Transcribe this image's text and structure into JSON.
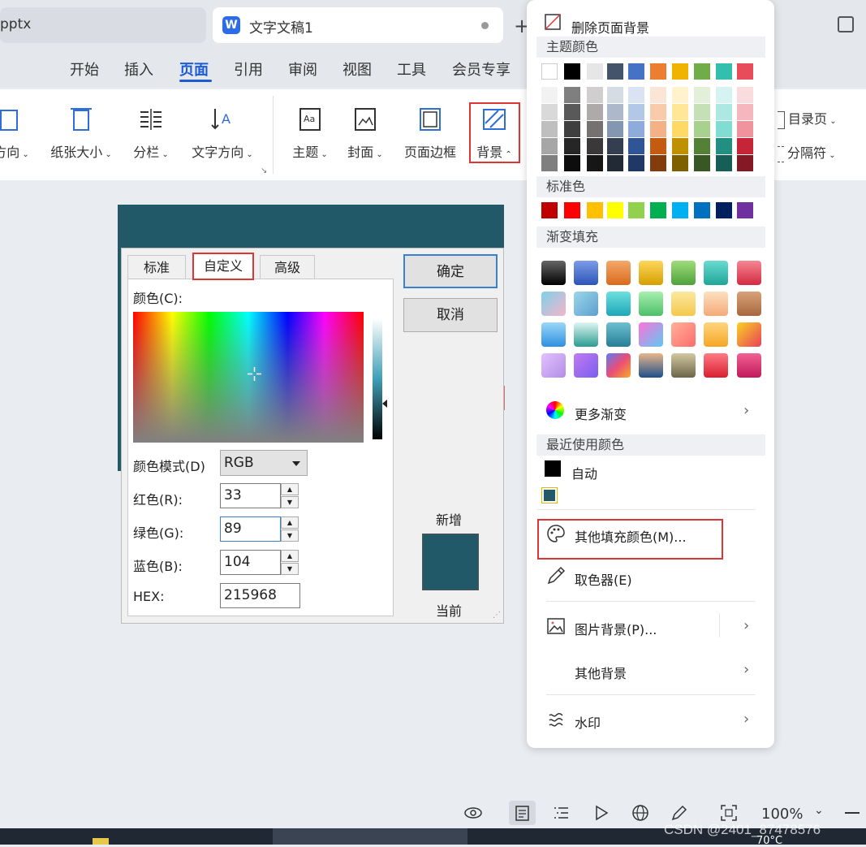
{
  "tabs": {
    "file1": "pptx",
    "file2": "文字文稿1",
    "file2_logo": "W"
  },
  "menu": [
    "开始",
    "插入",
    "页面",
    "引用",
    "审阅",
    "视图",
    "工具",
    "会员专享"
  ],
  "ribbon": {
    "orientation": "方向",
    "paper_size": "纸张大小",
    "columns": "分栏",
    "text_direction": "文字方向",
    "theme": "主题",
    "cover": "封面",
    "page_border": "页面边框",
    "background": "背景",
    "toc_page": "目录页",
    "separator": "分隔符"
  },
  "dialog": {
    "tabs": [
      "标准",
      "自定义",
      "高级"
    ],
    "color_label": "颜色(C):",
    "mode_label": "颜色模式(D)",
    "mode_value": "RGB",
    "red_label": "红色(R):",
    "red_value": "33",
    "green_label": "绿色(G):",
    "green_value": "89",
    "blue_label": "蓝色(B):",
    "blue_value": "104",
    "hex_label": "HEX:",
    "hex_value": "215968",
    "ok": "确定",
    "cancel": "取消",
    "new_label": "新增",
    "current_label": "当前"
  },
  "dropdown": {
    "remove_bg": "删除页面背景",
    "theme_colors": "主题颜色",
    "standard_colors": "标准色",
    "gradient_fill": "渐变填充",
    "more_gradients": "更多渐变",
    "recent_colors": "最近使用颜色",
    "auto": "自动",
    "other_fill": "其他填充颜色(M)...",
    "eyedropper": "取色器(E)",
    "picture_bg": "图片背景(P)...",
    "other_bg": "其他背景",
    "watermark": "水印"
  },
  "theme_top_row": [
    "#ffffff",
    "#000000",
    "#e7e6e6",
    "#44546a",
    "#4472c4",
    "#ed7d31",
    "#f0b400",
    "#70ad47",
    "#33bfae",
    "#e84c5a"
  ],
  "theme_shades": [
    [
      "#f2f2f2",
      "#7f7f7f",
      "#d0cece",
      "#d6dce4",
      "#dae3f3",
      "#fbe5d6",
      "#fff2cc",
      "#e2f0d9",
      "#d5f4f1",
      "#fadbde"
    ],
    [
      "#d9d9d9",
      "#595959",
      "#aeaaaa",
      "#adb9ca",
      "#b4c7e7",
      "#f8cbad",
      "#ffe699",
      "#c5e0b4",
      "#abe9e2",
      "#f5b7bd"
    ],
    [
      "#bfbfbf",
      "#3f3f3f",
      "#757171",
      "#8497b0",
      "#8faadc",
      "#f4b183",
      "#ffd966",
      "#a9d18e",
      "#80ddd3",
      "#f0939c"
    ],
    [
      "#a6a6a6",
      "#262626",
      "#3a3838",
      "#333f50",
      "#2f5597",
      "#c55a11",
      "#bf9000",
      "#548235",
      "#238f82",
      "#c62537"
    ],
    [
      "#7f7f7f",
      "#0d0d0d",
      "#171616",
      "#222a35",
      "#203864",
      "#843c0c",
      "#7f6000",
      "#385723",
      "#175f56",
      "#841925"
    ]
  ],
  "standard": [
    "#c00000",
    "#ff0000",
    "#ffc000",
    "#ffff00",
    "#92d050",
    "#00b050",
    "#00b0f0",
    "#0070c0",
    "#002060",
    "#7030a0"
  ],
  "gradients": [
    [
      "linear-gradient(#666,#000)",
      "linear-gradient(#7c9ce8,#2c55b8)",
      "linear-gradient(#f6a86a,#d96a1c)",
      "linear-gradient(#ffd65c,#d6a000)",
      "linear-gradient(#9edc7a,#4fa23a)",
      "linear-gradient(#6adbd0,#1fa699)",
      "linear-gradient(#f58793,#d22a40)"
    ],
    [
      "linear-gradient(135deg,#7fd0ea,#f5b5c9)",
      "linear-gradient(135deg,#9bd6e9,#5d9fd0)",
      "linear-gradient(#6ce0e0,#1ea7b8)",
      "linear-gradient(#a8efad,#4bc06a)",
      "linear-gradient(#fbe9a0,#f5c84b)",
      "linear-gradient(#fde0c0,#f5a978)",
      "linear-gradient(#d9a27a,#a8673e)"
    ],
    [
      "linear-gradient(#9ad8f8,#2f8fe0)",
      "linear-gradient(#dff5f2,#2a9d8f)",
      "linear-gradient(#6fc0cf,#257e97)",
      "linear-gradient(135deg,#ff72d8,#5cc9f5)",
      "linear-gradient(135deg,#ffb199,#ff6b6b)",
      "linear-gradient(#ffd57e,#f5a623)",
      "linear-gradient(135deg,#f9d423,#e94057)"
    ],
    [
      "linear-gradient(135deg,#e0c3fc,#b48ce8)",
      "linear-gradient(135deg,#c17cf0,#7a5cf0)",
      "linear-gradient(135deg,#5b7cf7,#e94e77,#f9a825)",
      "linear-gradient(#e8b68a,#1e4f8a)",
      "linear-gradient(#d2c9a2,#6b6447)",
      "linear-gradient(#ff7a85,#d81f30)",
      "linear-gradient(#f06292,#c2185b)"
    ]
  ],
  "recent_color": "#215968",
  "status": {
    "zoom": "100%"
  },
  "watermark_text": "CSDN @2401_87478576",
  "taskbar_temp": "70°C"
}
